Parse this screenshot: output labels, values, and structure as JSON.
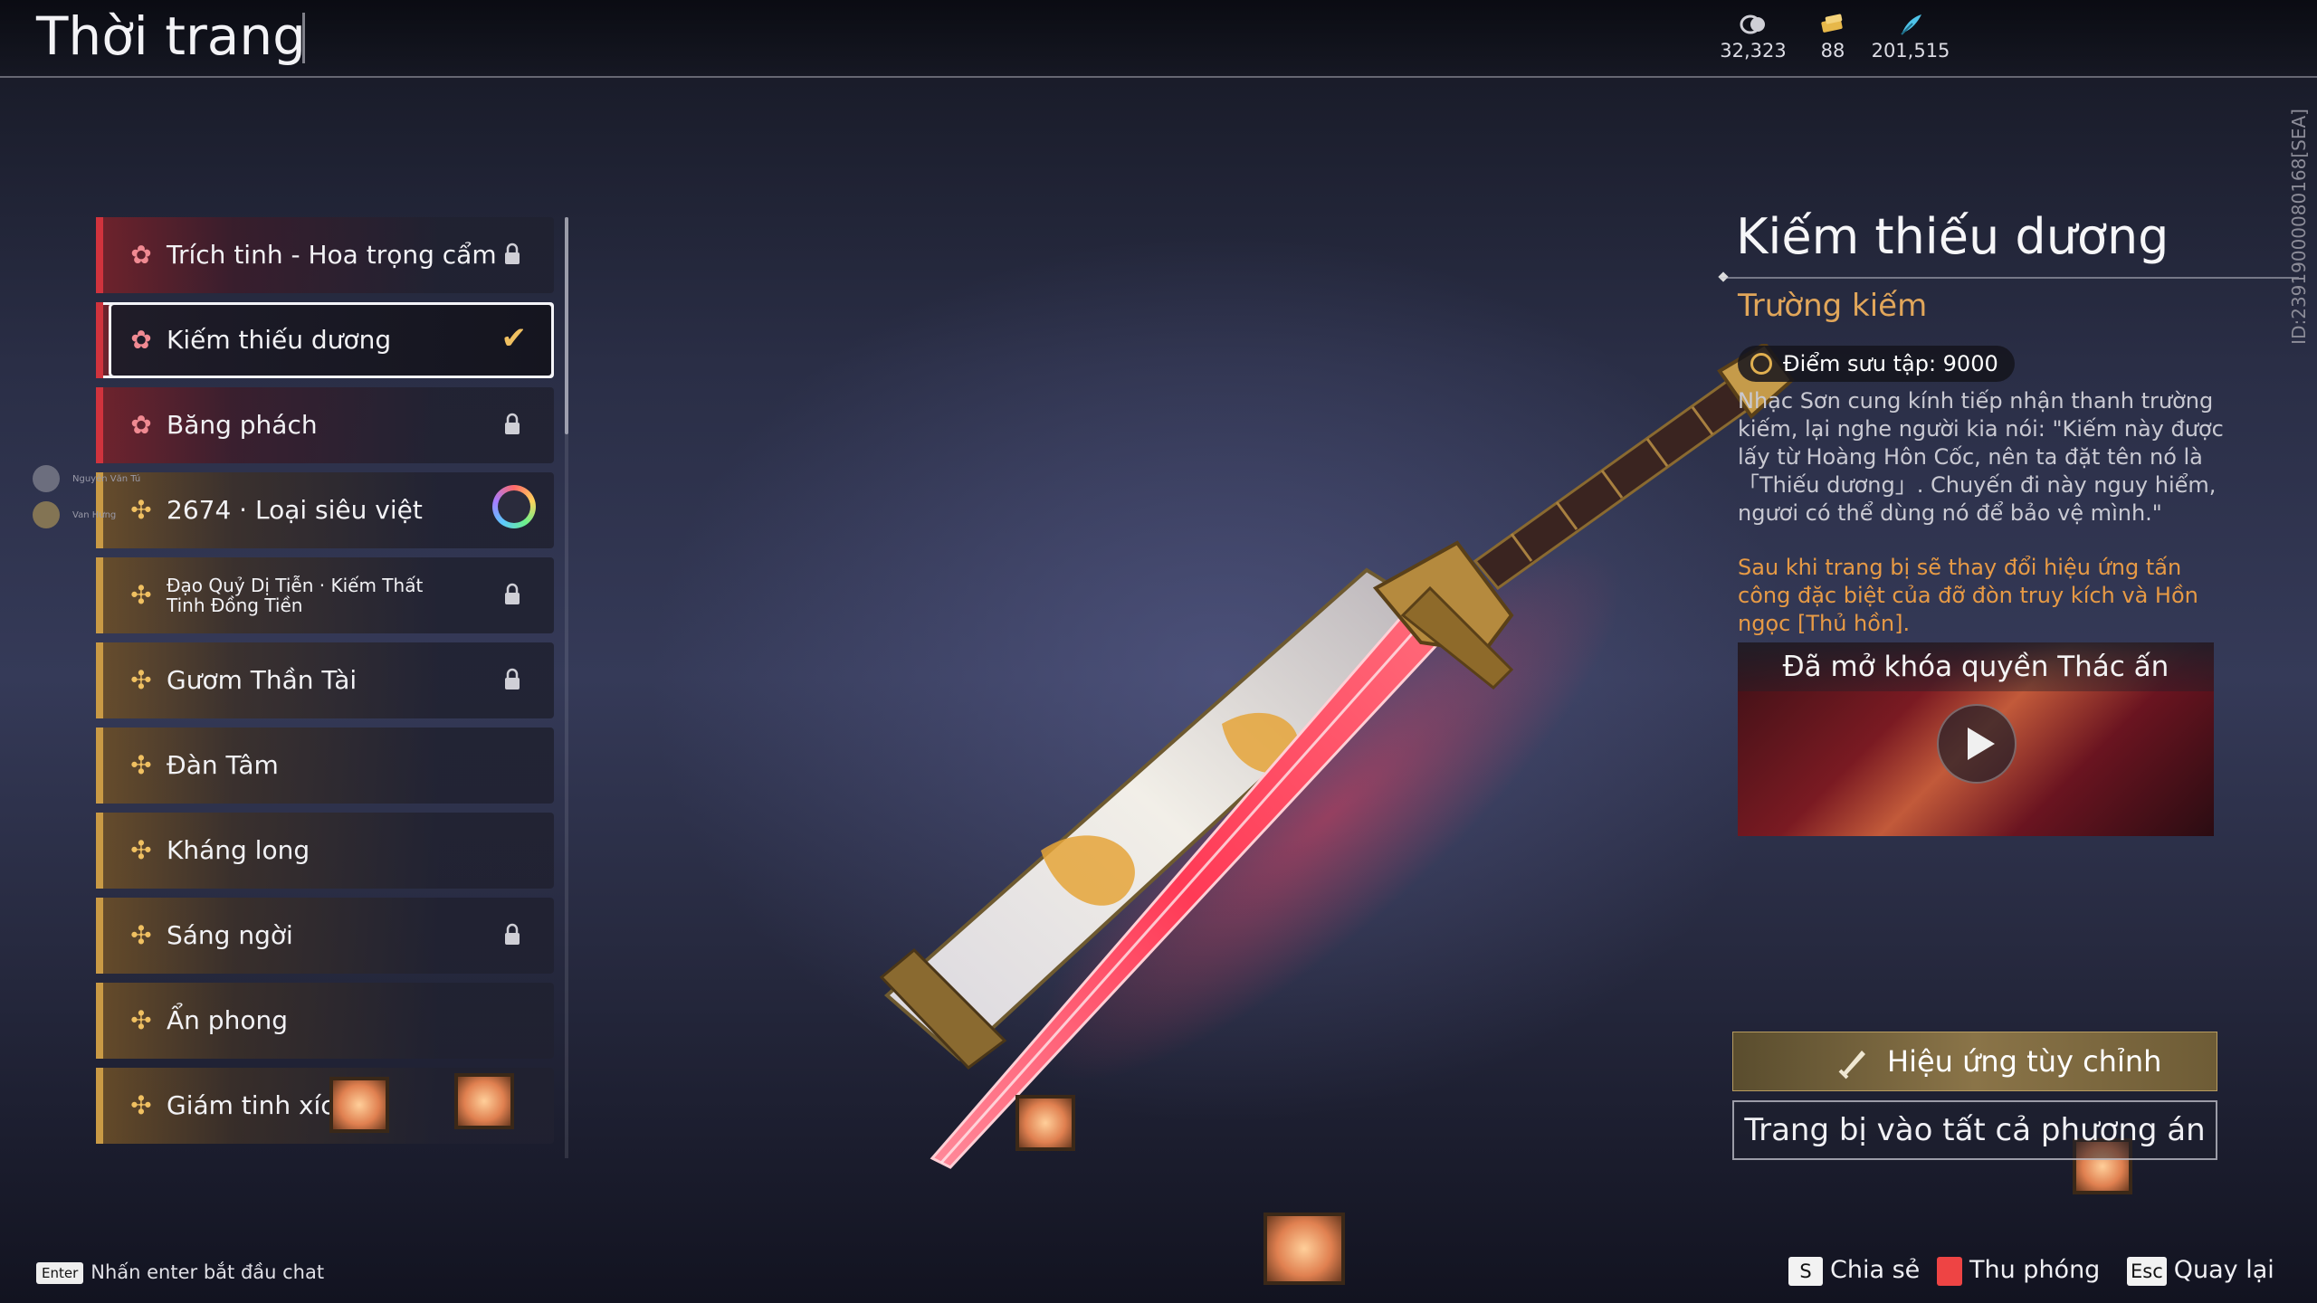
{
  "header": {
    "title": "Thời trang",
    "currencies": [
      {
        "icon": "coin-icon",
        "value": "32,323"
      },
      {
        "icon": "gold-ticket-icon",
        "value": "88"
      },
      {
        "icon": "feather-icon",
        "value": "201,515"
      }
    ]
  },
  "list": {
    "items": [
      {
        "label": "Trích tinh - Hoa trọng cẩm",
        "tone": "red",
        "status": "locked"
      },
      {
        "label": "Kiếm thiếu dương",
        "tone": "red",
        "status": "selected"
      },
      {
        "label": "Băng phách",
        "tone": "red",
        "status": "locked"
      },
      {
        "label": "2674 · Loại siêu việt",
        "tone": "gold",
        "status": "ring"
      },
      {
        "label": "Đạo Quỷ Dị Tiễn · Kiếm Thất Tinh Đồng Tiền",
        "tone": "gold",
        "status": "locked"
      },
      {
        "label": "Gươm Thần Tài",
        "tone": "gold",
        "status": "locked"
      },
      {
        "label": "Đàn Tâm",
        "tone": "gold",
        "status": "none"
      },
      {
        "label": "Kháng long",
        "tone": "gold",
        "status": "none"
      },
      {
        "label": "Sáng ngời",
        "tone": "gold",
        "status": "locked"
      },
      {
        "label": "Ẩn phong",
        "tone": "gold",
        "status": "none"
      },
      {
        "label": "Giám tinh xích",
        "tone": "gold",
        "status": "none"
      }
    ]
  },
  "chat": {
    "names": [
      "Nguyên Văn Tú",
      "Van Hưng"
    ]
  },
  "detail": {
    "name": "Kiếm thiếu dương",
    "type": "Trường kiếm",
    "points": "Điểm sưu tập: 9000",
    "description": "Nhạc Sơn cung kính tiếp nhận thanh trường kiếm, lại nghe người kia nói: \"Kiếm này được lấy từ Hoàng Hôn Cốc, nên ta đặt tên nó là 「Thiếu dương」. Chuyến đi này nguy hiểm, ngươi có thể dùng nó để bảo vệ mình.\"",
    "effect": "Sau khi trang bị sẽ thay đổi hiệu ứng tấn công đặc biệt của đỡ đòn truy kích và Hồn ngọc [Thủ hồn].",
    "video_title": "Đã mở khóa quyền Thác ấn",
    "custom_button": "Hiệu ứng tùy chỉnh",
    "equip_button": "Trang bị vào tất cả phương án",
    "id_text": "ID:23919000080168[SEA]"
  },
  "footer": {
    "chat_key": "Enter",
    "chat_hint": "Nhấn enter bắt đầu chat",
    "share_key": "S",
    "share_label": "Chia sẻ",
    "zoom_label": "Thu phóng",
    "back_key": "Esc",
    "back_label": "Quay lại"
  },
  "colors": {
    "accent_red": "#d0333d",
    "accent_gold": "#c99a45",
    "type_text": "#e1a65a",
    "effect_text": "#e79a45"
  }
}
